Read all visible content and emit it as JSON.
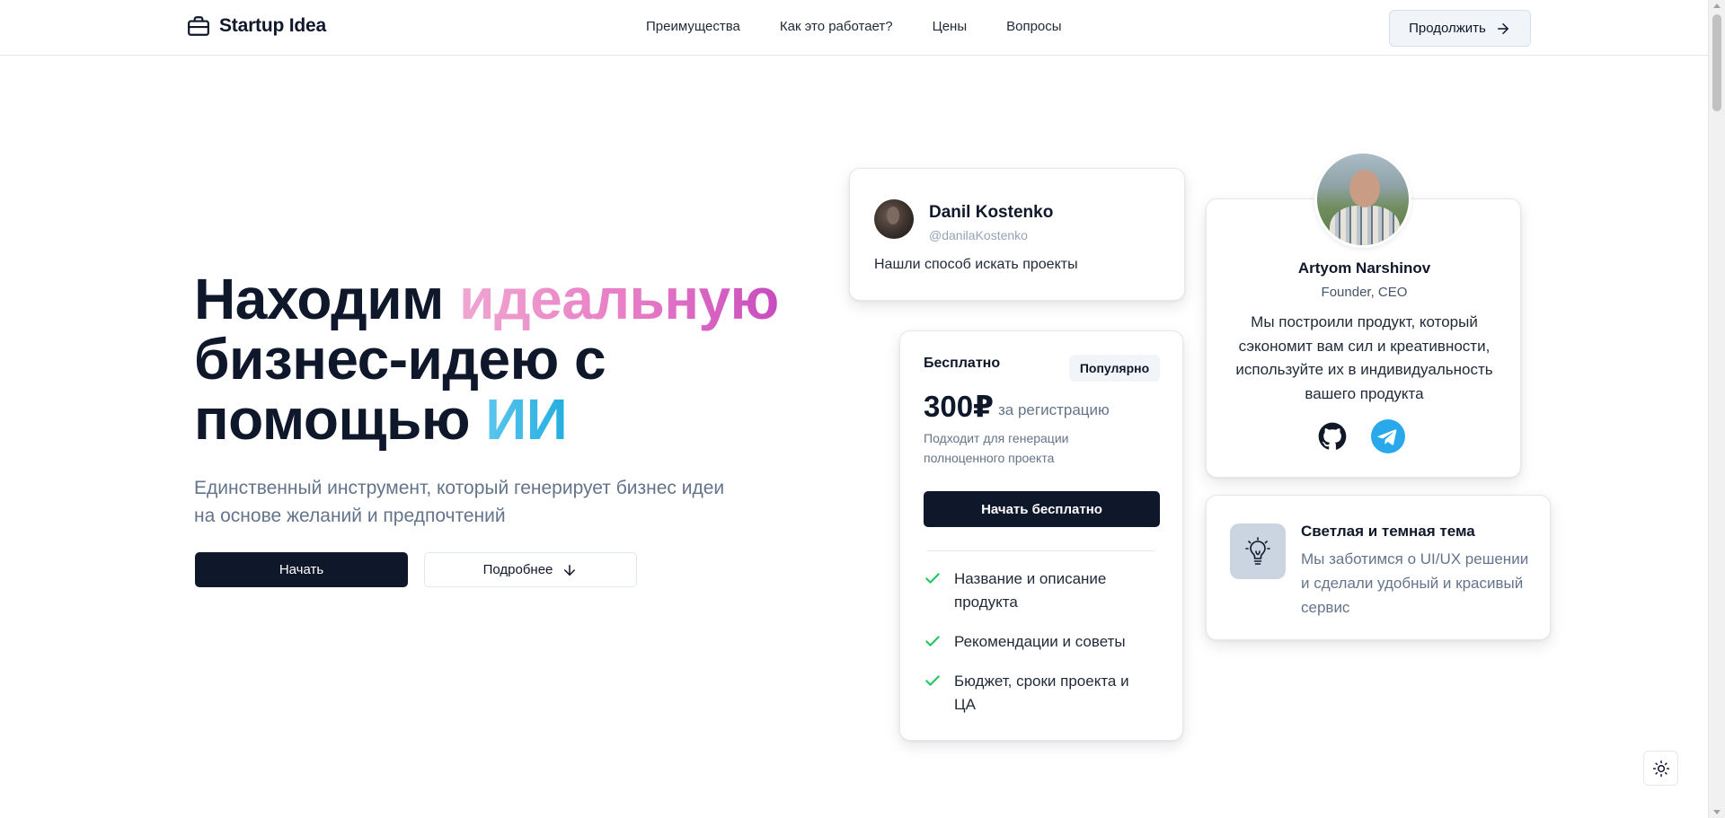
{
  "header": {
    "logo_text": "Startup Idea",
    "nav": [
      "Преимущества",
      "Как это работает?",
      "Цены",
      "Вопросы"
    ],
    "continue_label": "Продолжить"
  },
  "hero": {
    "title_part1": "Находим ",
    "title_highlight1": "идеальную",
    "title_part2": "бизнес-идею с помощью ",
    "title_highlight2": "ИИ",
    "subtitle": "Единственный инструмент, который генерирует бизнес идеи на основе желаний и предпочтений",
    "start_label": "Начать",
    "more_label": "Подробнее"
  },
  "testimonial": {
    "name": "Danil Kostenko",
    "handle": "@danilaKostenko",
    "text": "Нашли способ искать проекты"
  },
  "pricing": {
    "title": "Бесплатно",
    "badge": "Популярно",
    "price": "300₽",
    "price_note": "за регистрацию",
    "description": "Подходит для генерации полноценного проекта",
    "button_label": "Начать бесплатно",
    "features": [
      "Название и описание продукта",
      "Рекомендации и советы",
      "Бюджет, сроки проекта и ЦА"
    ]
  },
  "founder": {
    "name": "Artyom Narshinov",
    "role": "Founder, CEO",
    "text": "Мы построили продукт, который сэкономит вам сил и креативности, используйте их в индивидуальность вашего продукта"
  },
  "theme_card": {
    "title": "Светлая и темная тема",
    "text": "Мы заботимся о UI/UX решении и сделали удобный и красивый сервис"
  },
  "colors": {
    "primary": "#0f172a",
    "accent_pink": "#e77bc6",
    "accent_blue": "#22aee0",
    "check_green": "#22c55e",
    "telegram_blue": "#29a9eb"
  }
}
